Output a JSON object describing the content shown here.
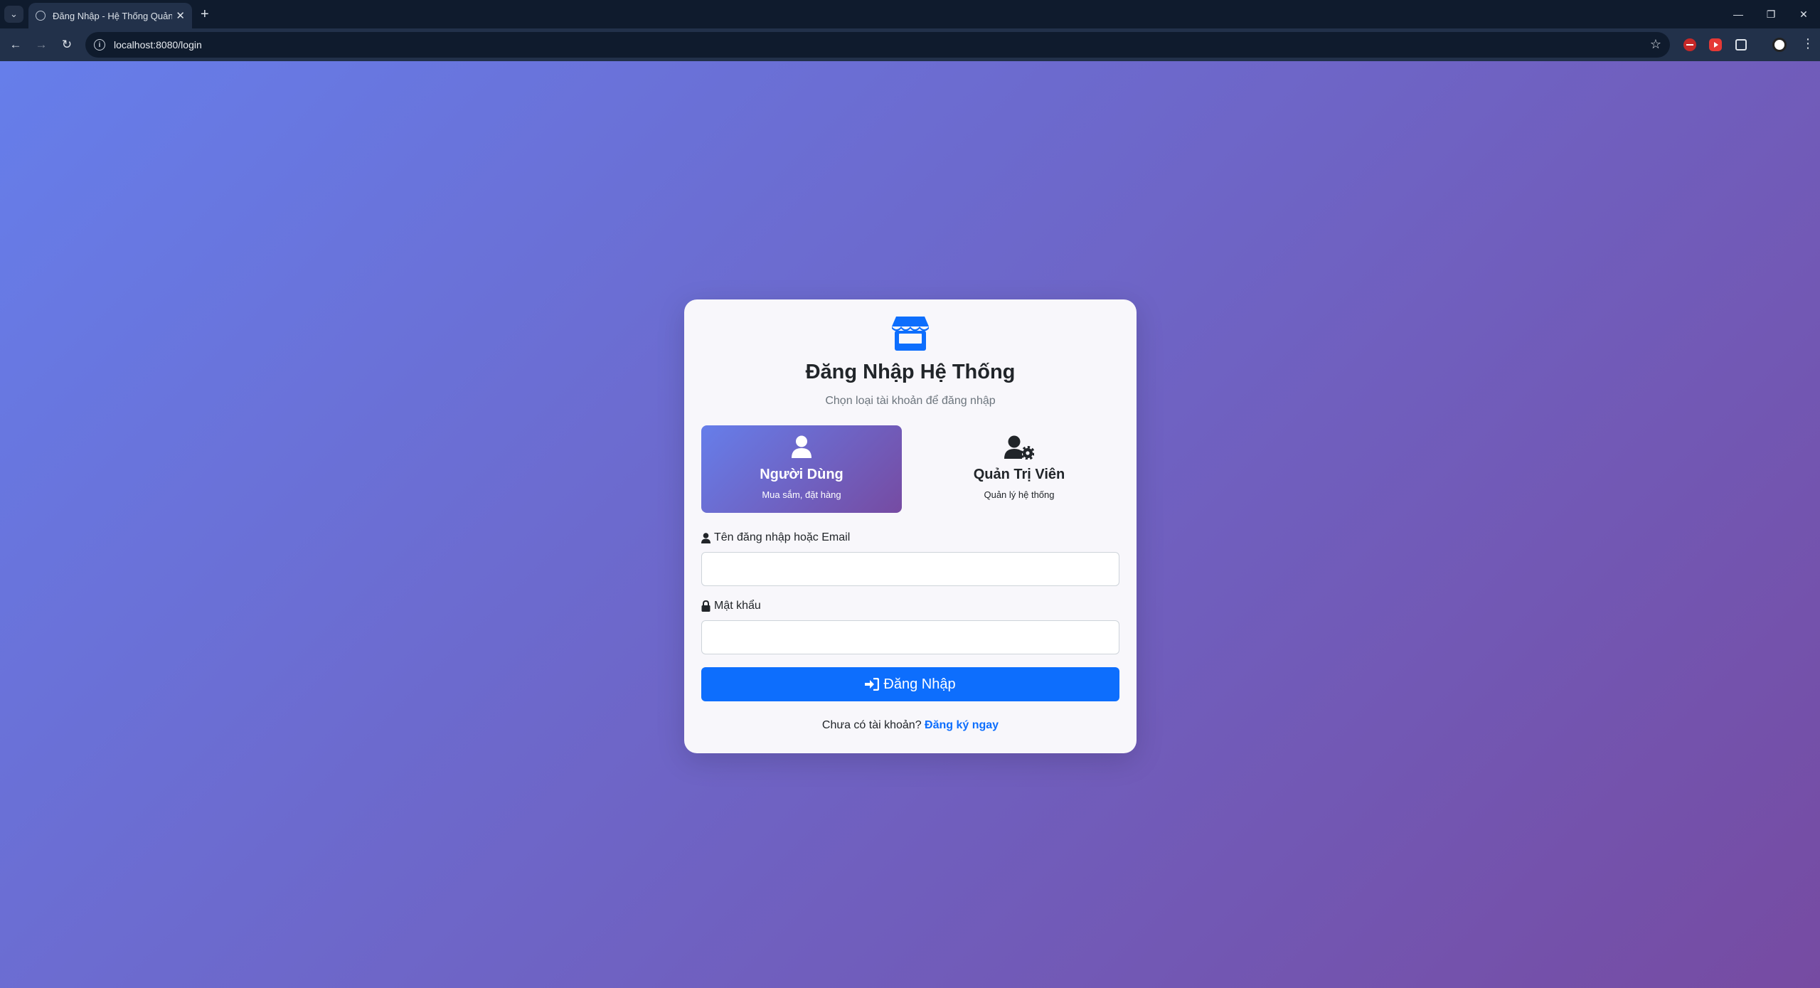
{
  "browser": {
    "tab_title": "Đăng Nhập - Hệ Thống Quản Lý",
    "tab_close": "✕",
    "new_tab": "+",
    "url": "localhost:8080/login",
    "window_controls": {
      "minimize": "—",
      "restore": "❐",
      "close": "✕"
    },
    "nav": {
      "back": "←",
      "forward": "→",
      "reload": "↻"
    },
    "star": "☆",
    "menu": "⋮",
    "tab_menu": "⌄"
  },
  "login": {
    "title": "Đăng Nhập Hệ Thống",
    "subtitle": "Chọn loại tài khoản để đăng nhập",
    "roles": [
      {
        "name": "Người Dùng",
        "desc": "Mua sắm, đặt hàng",
        "active": true
      },
      {
        "name": "Quản Trị Viên",
        "desc": "Quản lý hệ thống",
        "active": false
      }
    ],
    "username_label": "Tên đăng nhập hoặc Email",
    "username_value": "",
    "password_label": "Mật khẩu",
    "password_value": "",
    "submit_label": "Đăng Nhập",
    "footer_text": "Chưa có tài khoản?",
    "register_link": "Đăng ký ngay"
  },
  "colors": {
    "gradient_start": "#667eea",
    "gradient_end": "#764ba2",
    "primary": "#0d6efd"
  }
}
